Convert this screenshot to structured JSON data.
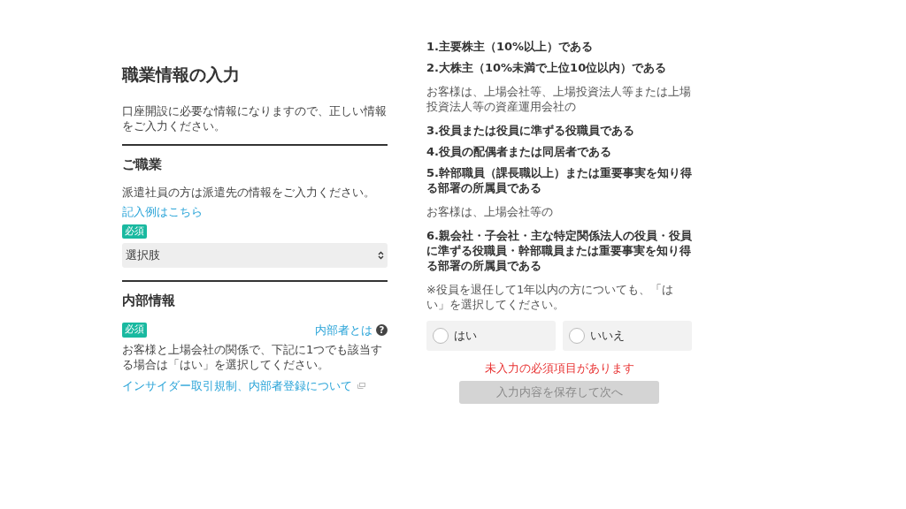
{
  "left": {
    "title": "職業情報の入力",
    "intro": "口座開設に必要な情報になりますので、正しい情報をご入力ください。",
    "sections": [
      {
        "heading": "ご職業",
        "kind": "occupation",
        "note": "派遣社員の方は派遣先の情報をご入力ください。",
        "link": "記入例はこちら",
        "badge": "必須",
        "select": {
          "value": "選択肢"
        }
      },
      {
        "heading": "内部情報",
        "kind": "insider",
        "badge": "必須",
        "help_link": "内部者とは",
        "help_icon": "?",
        "note": "お客様と上場会社の関係で、下記に1つでも該当する場合は「はい」を選択してください。",
        "link": "インサイダー取引規制、内部者登録について"
      }
    ]
  },
  "right": {
    "items": [
      {
        "kind": "item",
        "text": "1.主要株主（10%以上）である"
      },
      {
        "kind": "item",
        "text": "2.大株主（10%未満で上位10位以内）である"
      },
      {
        "kind": "note",
        "text": "お客様は、上場会社等、上場投資法人等または上場投資法人等の資産運用会社の"
      },
      {
        "kind": "item",
        "text": "3.役員または役員に準ずる役職員である"
      },
      {
        "kind": "item",
        "text": "4.役員の配偶者または同居者である"
      },
      {
        "kind": "item",
        "text": "5.幹部職員（課長職以上）または重要事実を知り得る部署の所属員である"
      },
      {
        "kind": "note",
        "text": "お客様は、上場会社等の"
      },
      {
        "kind": "item",
        "text": "6.親会社・子会社・主な特定関係法人の役員・役員に準ずる役職員・幹部職員または重要事実を知り得る部署の所属員である"
      },
      {
        "kind": "note",
        "text": "※役員を退任して1年以内の方についても、「はい」を選択してください。"
      }
    ],
    "options": [
      {
        "label": "はい",
        "selected": false
      },
      {
        "label": "いいえ",
        "selected": false
      }
    ],
    "error": "未入力の必須項目があります",
    "submit": {
      "label": "入力内容を保存して次へ",
      "disabled": true
    }
  }
}
